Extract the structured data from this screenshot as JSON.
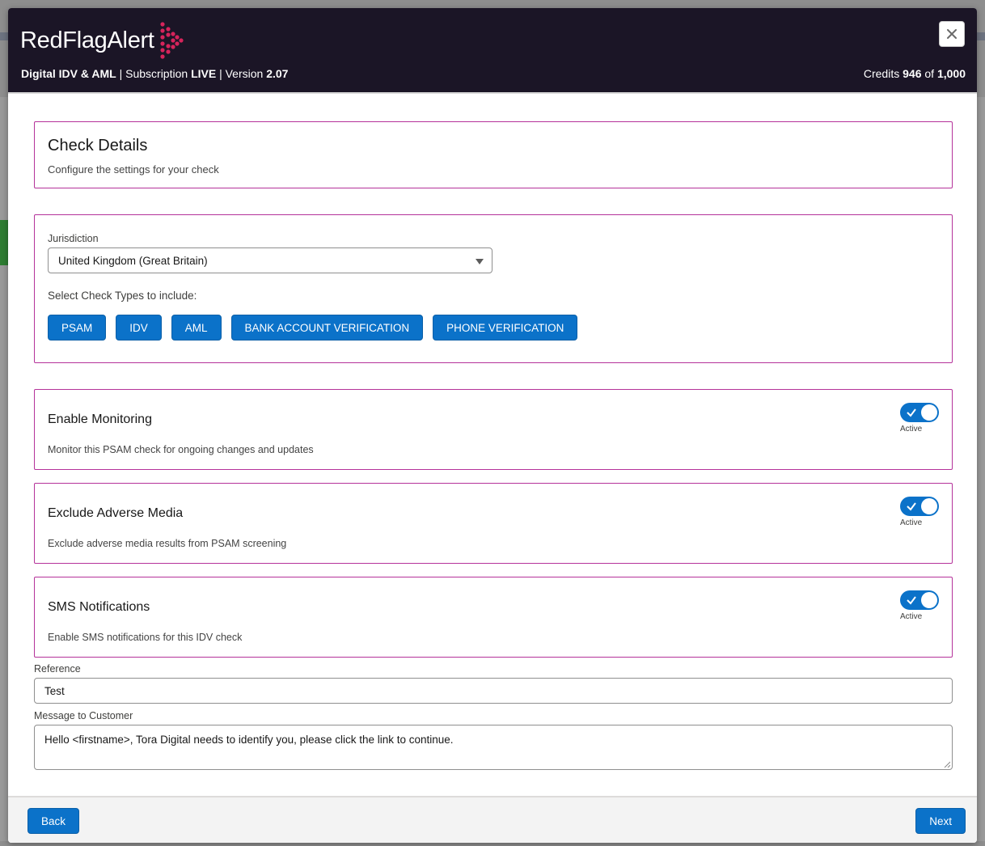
{
  "header": {
    "logo_text": "RedFlagAlert",
    "product": "Digital IDV & AML",
    "subscription_label": "Subscription",
    "subscription_value": "LIVE",
    "version_label": "Version",
    "version_value": "2.07",
    "credits_label": "Credits",
    "credits_used": "946",
    "credits_of": "of",
    "credits_total": "1,000",
    "close_icon": "close-icon"
  },
  "check_details": {
    "title": "Check Details",
    "subtitle": "Configure the settings for your check"
  },
  "jurisdiction": {
    "label": "Jurisdiction",
    "selected": "United Kingdom (Great Britain)",
    "check_types_label": "Select Check Types to include:",
    "check_types": [
      "PSAM",
      "IDV",
      "AML",
      "BANK ACCOUNT VERIFICATION",
      "PHONE VERIFICATION"
    ]
  },
  "settings": [
    {
      "title": "Enable Monitoring",
      "description": "Monitor this PSAM check for ongoing changes and updates",
      "toggle_label": "Active",
      "enabled": true
    },
    {
      "title": "Exclude Adverse Media",
      "description": "Exclude adverse media results from PSAM screening",
      "toggle_label": "Active",
      "enabled": true
    },
    {
      "title": "SMS Notifications",
      "description": "Enable SMS notifications for this IDV check",
      "toggle_label": "Active",
      "enabled": true
    }
  ],
  "reference": {
    "label": "Reference",
    "value": "Test"
  },
  "message": {
    "label": "Message to Customer",
    "value": "Hello <firstname>, Tora Digital needs to identify you, please click the link to continue."
  },
  "footer": {
    "back_label": "Back",
    "next_label": "Next"
  },
  "colors": {
    "header_bg": "#1b1526",
    "accent": "#0b72c9",
    "card_border": "#b5329a",
    "logo_mark": "#d6245b"
  }
}
